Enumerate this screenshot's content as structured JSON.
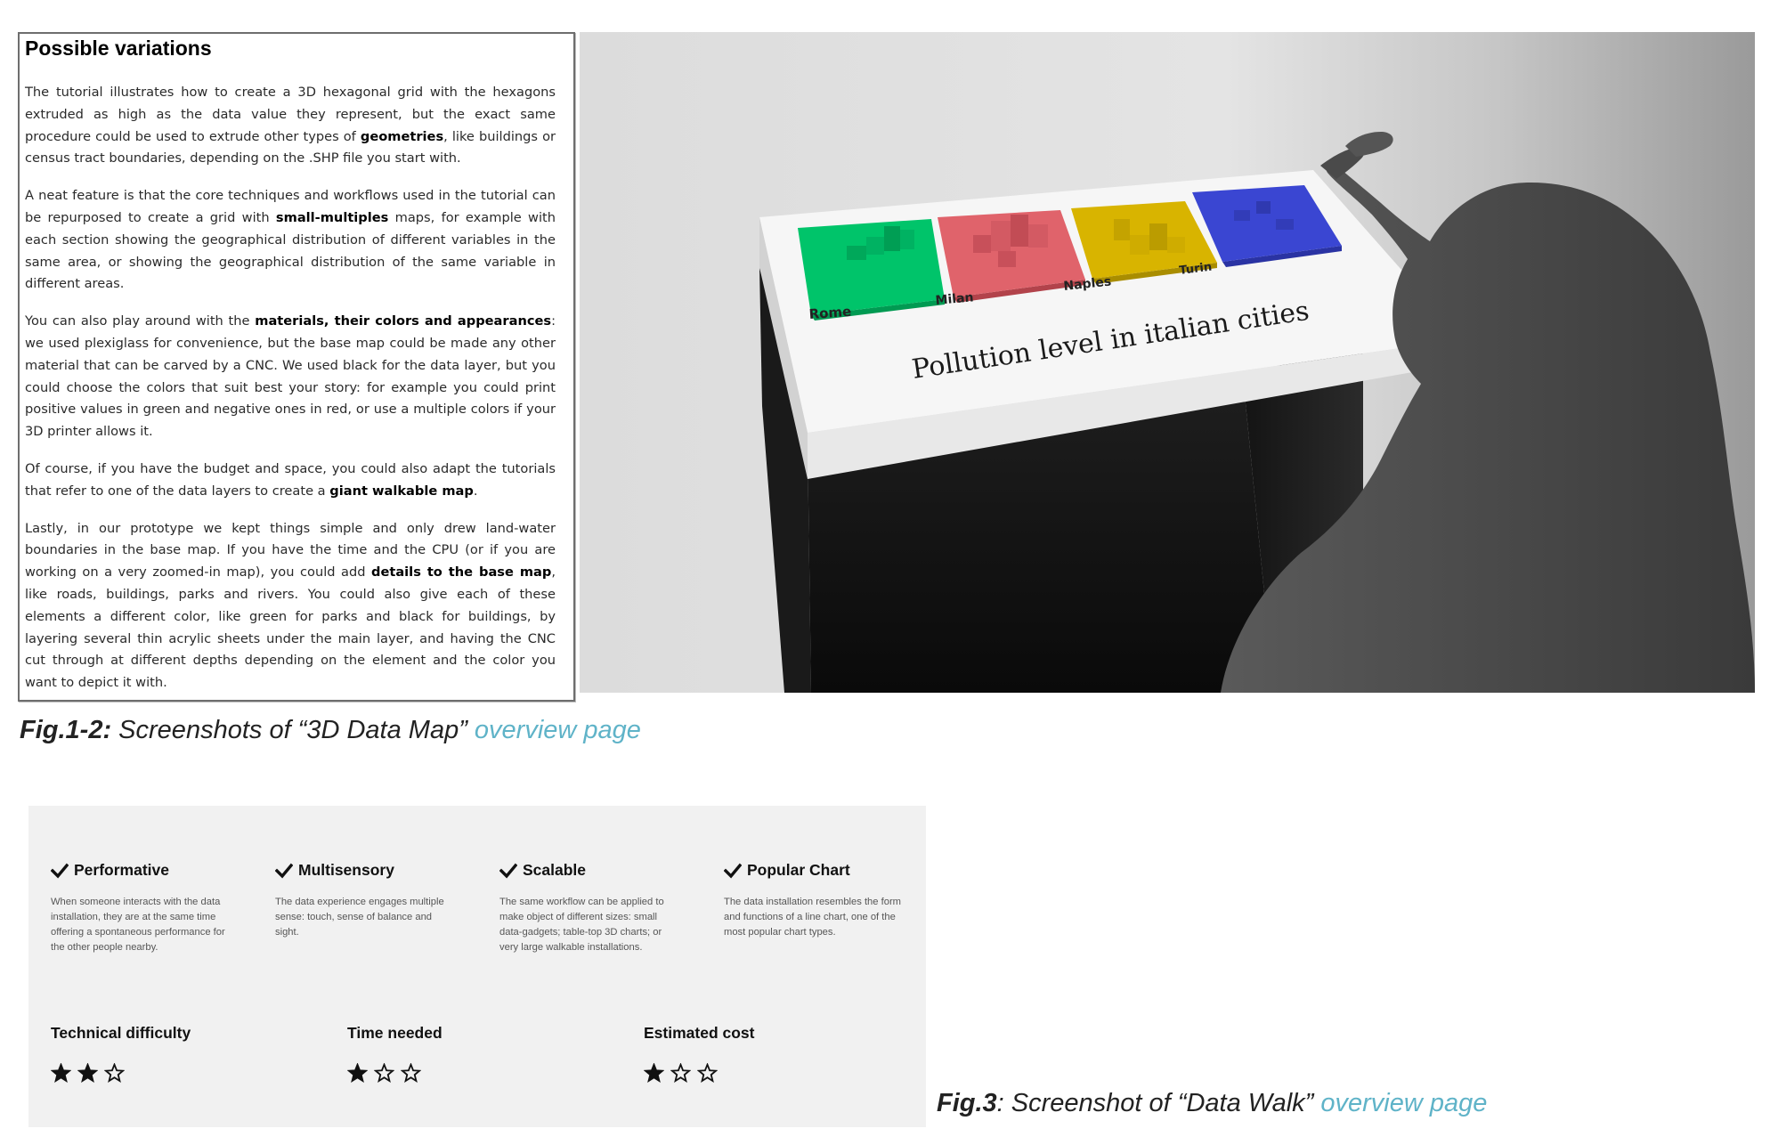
{
  "article": {
    "title": "Possible variations",
    "paragraphs": [
      [
        {
          "t": "The tutorial illustrates how to create a 3D hexagonal grid with the hexagons extruded as high as the data value they represent, but the exact same procedure could be used to extrude other types of "
        },
        {
          "t": "geometries",
          "b": true
        },
        {
          "t": ", like buildings or census tract boundaries, depending on the .SHP file you start with."
        }
      ],
      [
        {
          "t": "A neat feature is that the core techniques and workflows used in the tutorial can be repurposed to create a grid with "
        },
        {
          "t": "small-multiples",
          "b": true
        },
        {
          "t": " maps, for example with each section showing the geographical distribution of different variables in the same area, or showing the geographical distribution of the same variable in different areas."
        }
      ],
      [
        {
          "t": "You can also play around with the "
        },
        {
          "t": "materials, their colors and appearances",
          "b": true
        },
        {
          "t": ": we used plexiglass for convenience, but the base map could be made any other material that can be carved by a CNC. We used black for the data layer, but you could choose the colors that suit best your story: for example you could print positive values in green and negative ones in red, or use a multiple colors if your 3D printer allows it."
        }
      ],
      [
        {
          "t": "Of course, if you have the budget and space, you could also adapt the tutorials that refer to one of the data layers to create a "
        },
        {
          "t": "giant walkable map",
          "b": true
        },
        {
          "t": "."
        }
      ],
      [
        {
          "t": "Lastly, in our prototype we kept things simple and only drew land-water boundaries in the base map. If you have the time and the CPU (or if you are working on a very zoomed-in map), you could add "
        },
        {
          "t": "details to the base map",
          "b": true
        },
        {
          "t": ", like roads, buildings, parks and rivers. You could also give each of these elements a different color, like green for parks and black for buildings, by layering several thin acrylic sheets under the main layer, and having the CNC cut through at different depths depending on the element and the color you want to depict it with."
        }
      ]
    ]
  },
  "render": {
    "title": "Pollution level in italian cities",
    "cities": [
      "Rome",
      "Milan",
      "Naples",
      "Turin"
    ],
    "city_colors": [
      "#00c46a",
      "#e0636b",
      "#d8b400",
      "#3a46d2"
    ]
  },
  "captions": {
    "fig12": {
      "label": "Fig.1-2:",
      "text": " Screenshots of “3D Data Map” ",
      "link": "overview page"
    },
    "fig3": {
      "label": "Fig.3",
      "text": ": Screenshot of “Data Walk” ",
      "link": "overview page"
    }
  },
  "overview": {
    "features": [
      {
        "title": "Performative",
        "desc": "When someone interacts with the data installation, they are at the same time offering a spontaneous performance for the other people nearby."
      },
      {
        "title": "Multisensory",
        "desc": "The data experience engages multiple sense: touch, sense of balance and sight."
      },
      {
        "title": "Scalable",
        "desc": "The same workflow can be applied to make object of different sizes: small data-gadgets; table-top 3D charts; or very large walkable installations."
      },
      {
        "title": "Popular Chart",
        "desc": "The data installation resembles the form and functions of a line chart, one of the most popular chart types."
      }
    ],
    "ratings": [
      {
        "label": "Technical difficulty",
        "value": 2,
        "max": 3
      },
      {
        "label": "Time needed",
        "value": 1,
        "max": 3
      },
      {
        "label": "Estimated cost",
        "value": 1,
        "max": 3
      }
    ],
    "icons": {
      "feature": "check-icon",
      "rating_filled": "star-filled-icon",
      "rating_empty": "star-outline-icon"
    },
    "link_color": "#5fb3c8",
    "panel_bg": "#f1f1f1"
  }
}
